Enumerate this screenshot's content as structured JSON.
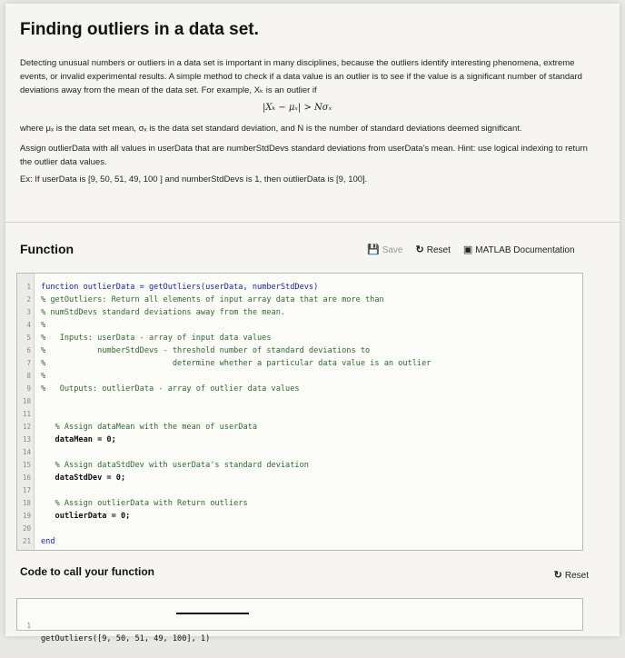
{
  "title": "Finding outliers in a data set.",
  "paragraphs": {
    "intro": "Detecting unusual numbers or outliers in a data set is important in many disciplines, because the outliers identify interesting phenomena, extreme events, or invalid experimental results. A simple method to check if a data value is an outlier is to see if the value is a significant number of standard deviations away from the mean of the data set. For example, Xₖ is an outlier if",
    "formula": "|Xₖ − μₓ| > Nσₓ",
    "where": "where μₓ is the data set mean, σₓ is the data set standard deviation, and N is the number of standard deviations deemed significant.",
    "assign": "Assign outlierData with all values in userData that are numberStdDevs standard deviations from userData's mean. Hint: use logical indexing to return the outlier data values.",
    "example": "Ex: If userData is [9, 50, 51, 49, 100 ] and numberStdDevs is 1, then outlierData is [9, 100]."
  },
  "function_section": {
    "title": "Function",
    "save_label": "Save",
    "reset_label": "Reset",
    "docs_label": "MATLAB Documentation"
  },
  "code_lines": [
    {
      "n": "1",
      "text": "function outlierData = getOutliers(userData, numberStdDevs)",
      "style": "kw"
    },
    {
      "n": "2",
      "text": "% getOutliers: Return all elements of input array data that are more than",
      "style": "comment"
    },
    {
      "n": "3",
      "text": "% numStdDevs standard deviations away from the mean.",
      "style": "comment"
    },
    {
      "n": "4",
      "text": "%",
      "style": "comment"
    },
    {
      "n": "5",
      "text": "%   Inputs: userData - array of input data values",
      "style": "comment"
    },
    {
      "n": "6",
      "text": "%           numberStdDevs - threshold number of standard deviations to",
      "style": "comment"
    },
    {
      "n": "7",
      "text": "%                           determine whether a particular data value is an outlier",
      "style": "comment"
    },
    {
      "n": "8",
      "text": "%",
      "style": "comment"
    },
    {
      "n": "9",
      "text": "%   Outputs: outlierData - array of outlier data values",
      "style": "comment"
    },
    {
      "n": "10",
      "text": "",
      "style": ""
    },
    {
      "n": "11",
      "text": "",
      "style": ""
    },
    {
      "n": "12",
      "text": "   % Assign dataMean with the mean of userData",
      "style": "comment"
    },
    {
      "n": "13",
      "text": "   dataMean = 0;",
      "style": "bold"
    },
    {
      "n": "14",
      "text": "",
      "style": ""
    },
    {
      "n": "15",
      "text": "   % Assign dataStdDev with userData's standard deviation",
      "style": "comment"
    },
    {
      "n": "16",
      "text": "   dataStdDev = 0;",
      "style": "bold"
    },
    {
      "n": "17",
      "text": "",
      "style": ""
    },
    {
      "n": "18",
      "text": "   % Assign outlierData with Return outliers",
      "style": "comment"
    },
    {
      "n": "19",
      "text": "   outlierData = 0;",
      "style": "bold"
    },
    {
      "n": "20",
      "text": "",
      "style": ""
    },
    {
      "n": "21",
      "text": "end",
      "style": "kw"
    }
  ],
  "call_section": {
    "title": "Code to call your function",
    "reset_label": "Reset",
    "line_number": "1",
    "code": "getOutliers([9, 50, 51, 49, 100], 1)"
  },
  "icons": {
    "save": "save-icon",
    "reset": "reset-icon",
    "docs": "book-icon"
  },
  "colors": {
    "keyword": "#1a22b5",
    "comment": "#2d6a2d"
  }
}
